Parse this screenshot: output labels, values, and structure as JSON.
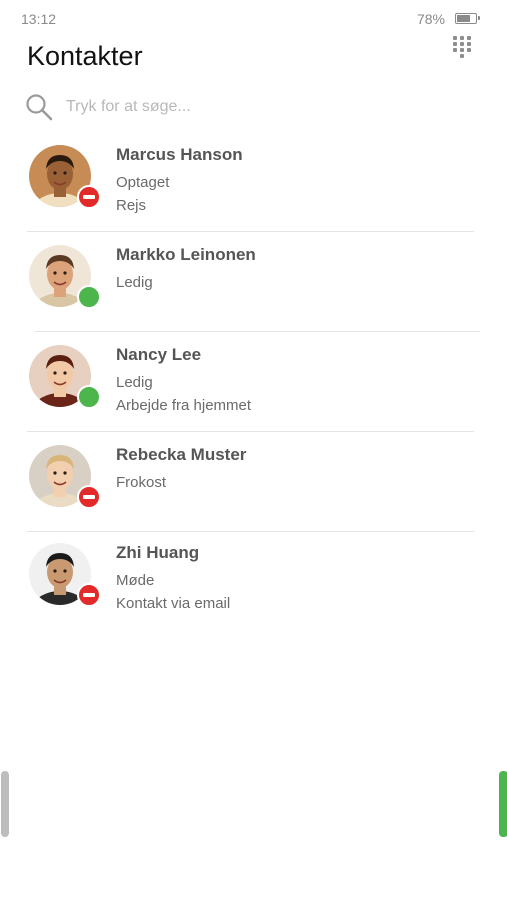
{
  "status_bar": {
    "time": "13:12",
    "battery_percent": "78%",
    "battery_level": 0.78
  },
  "header": {
    "title": "Kontakter"
  },
  "search": {
    "placeholder": "Tryk for at søge..."
  },
  "colors": {
    "busy": "#e32a2a",
    "available": "#4cb64c",
    "handle_left": "#bdbdbd",
    "handle_right": "#4cb64c"
  },
  "contacts": [
    {
      "name": "Marcus Hanson",
      "presence": "busy",
      "status": "Optaget",
      "note": "Rejs",
      "avatar": {
        "bg": "#c78b55",
        "skin": "#9a6036",
        "hair": "#2a1a0e",
        "shirt": "#f0e0c0"
      }
    },
    {
      "name": "Markko Leinonen",
      "presence": "available",
      "status": "Ledig",
      "note": "",
      "avatar": {
        "bg": "#efe6d8",
        "skin": "#dca27a",
        "hair": "#5a3a22",
        "shirt": "#d9c6a4"
      }
    },
    {
      "name": "Nancy Lee",
      "presence": "available",
      "status": "Ledig",
      "note": "Arbejde fra hjemmet",
      "avatar": {
        "bg": "#e8d0c0",
        "skin": "#f1c9a7",
        "hair": "#5b1f12",
        "shirt": "#6a2418"
      }
    },
    {
      "name": "Rebecka Muster",
      "presence": "busy",
      "status": "Frokost",
      "note": "",
      "avatar": {
        "bg": "#d8d0c4",
        "skin": "#f2cfae",
        "hair": "#d9b57a",
        "shirt": "#eadcc4"
      }
    },
    {
      "name": "Zhi Huang",
      "presence": "busy",
      "status": "Møde",
      "note": "Kontakt via email",
      "avatar": {
        "bg": "#f0f0f0",
        "skin": "#c99a72",
        "hair": "#1a1a1a",
        "shirt": "#2a2a2a"
      }
    }
  ]
}
